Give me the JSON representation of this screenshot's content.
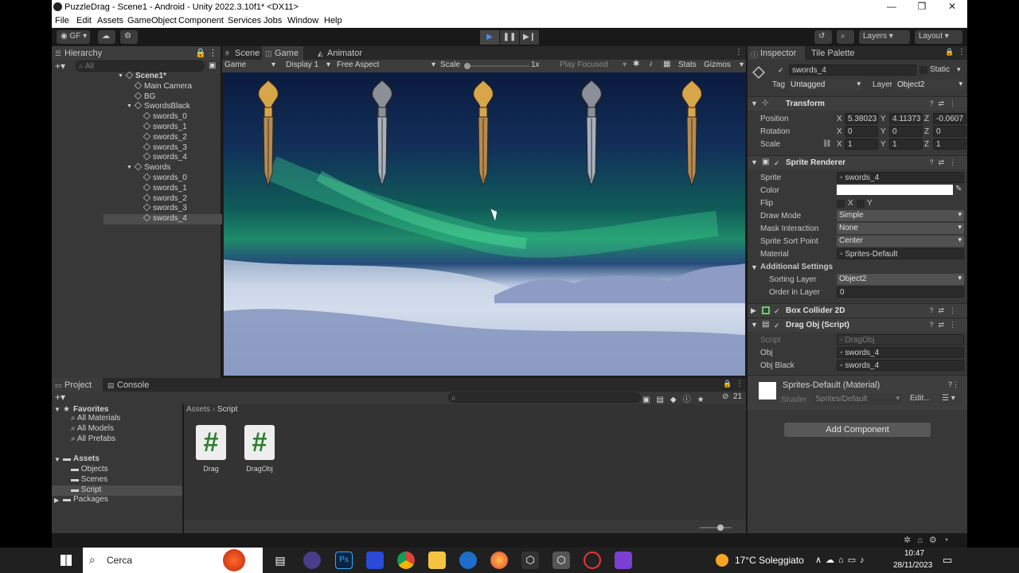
{
  "window": {
    "title": "PuzzleDrag - Scene1 - Android - Unity 2022.3.10f1* <DX11>"
  },
  "menu": [
    "File",
    "Edit",
    "Assets",
    "GameObject",
    "Component",
    "Services",
    "Jobs",
    "Window",
    "Help"
  ],
  "toolbar": {
    "account": "GF",
    "layers": "Layers",
    "layout": "Layout"
  },
  "tabs": {
    "scene": "Scene",
    "game": "Game",
    "animator": "Animator",
    "hierarchy": "Hierarchy",
    "inspector": "Inspector",
    "tile_palette": "Tile Palette",
    "project": "Project",
    "console": "Console"
  },
  "game_bar": {
    "mode": "Game",
    "display": "Display 1",
    "aspect": "Free Aspect",
    "scale_label": "Scale",
    "scale_value": "1x",
    "play_focused": "Play Focused",
    "stats": "Stats",
    "gizmos": "Gizmos"
  },
  "hierarchy": {
    "search_placeholder": "All",
    "items": [
      {
        "label": "Scene1*",
        "indent": 0
      },
      {
        "label": "Main Camera",
        "indent": 1
      },
      {
        "label": "BG",
        "indent": 1
      },
      {
        "label": "SwordsBlack",
        "indent": 1
      },
      {
        "label": "swords_0",
        "indent": 2
      },
      {
        "label": "swords_1",
        "indent": 2
      },
      {
        "label": "swords_2",
        "indent": 2
      },
      {
        "label": "swords_3",
        "indent": 2
      },
      {
        "label": "swords_4",
        "indent": 2
      },
      {
        "label": "Swords",
        "indent": 1
      },
      {
        "label": "swords_0",
        "indent": 2
      },
      {
        "label": "swords_1",
        "indent": 2
      },
      {
        "label": "swords_2",
        "indent": 2
      },
      {
        "label": "swords_3",
        "indent": 2
      },
      {
        "label": "swords_4",
        "indent": 2,
        "selected": true
      }
    ]
  },
  "inspector": {
    "object_name": "swords_4",
    "static_label": "Static",
    "tag_label": "Tag",
    "tag_value": "Untagged",
    "layer_label": "Layer",
    "layer_value": "Object2",
    "transform": {
      "title": "Transform",
      "position": {
        "label": "Position",
        "x": "5.38023",
        "y": "4.11373",
        "z": "-0.0607"
      },
      "rotation": {
        "label": "Rotation",
        "x": "0",
        "y": "0",
        "z": "0"
      },
      "scale": {
        "label": "Scale",
        "x": "1",
        "y": "1",
        "z": "1"
      }
    },
    "sprite_renderer": {
      "title": "Sprite Renderer",
      "sprite_label": "Sprite",
      "sprite_value": "swords_4",
      "color_label": "Color",
      "flip_label": "Flip",
      "flip_x": "X",
      "flip_y": "Y",
      "draw_mode_label": "Draw Mode",
      "draw_mode_value": "Simple",
      "mask_label": "Mask Interaction",
      "mask_value": "None",
      "sort_point_label": "Sprite Sort Point",
      "sort_point_value": "Center",
      "material_label": "Material",
      "material_value": "Sprites-Default",
      "additional": "Additional Settings",
      "sorting_layer_label": "Sorting Layer",
      "sorting_layer_value": "Object2",
      "order_label": "Order in Layer",
      "order_value": "0"
    },
    "box_collider": {
      "title": "Box Collider 2D"
    },
    "drag_obj": {
      "title": "Drag Obj (Script)",
      "script_label": "Script",
      "script_value": "DragObj",
      "obj_label": "Obj",
      "obj_value": "swords_4",
      "obj_black_label": "Obj Black",
      "obj_black_value": "swords_4"
    },
    "material": {
      "title": "Sprites-Default (Material)",
      "shader_label": "Shader",
      "shader_value": "Sprites/Default",
      "edit": "Edit..."
    },
    "add_component": "Add Component"
  },
  "project": {
    "favorites": "Favorites",
    "fav_items": [
      "All Materials",
      "All Models",
      "All Prefabs"
    ],
    "assets": "Assets",
    "asset_folders": [
      "Objects",
      "Scenes",
      "Script"
    ],
    "packages": "Packages",
    "breadcrumb_root": "Assets",
    "breadcrumb_current": "Script",
    "files": [
      {
        "name": "Drag",
        "glyph": "#"
      },
      {
        "name": "DragObj",
        "glyph": "#"
      }
    ],
    "hidden_count": "21"
  },
  "taskbar": {
    "search": "Cerca",
    "weather": "17°C Soleggiato",
    "time": "10:47",
    "date": "28/11/2023"
  },
  "colors": {
    "selected_row": "#4d4d4d",
    "panel": "#383838",
    "accent_play": "#4c8bf5"
  }
}
